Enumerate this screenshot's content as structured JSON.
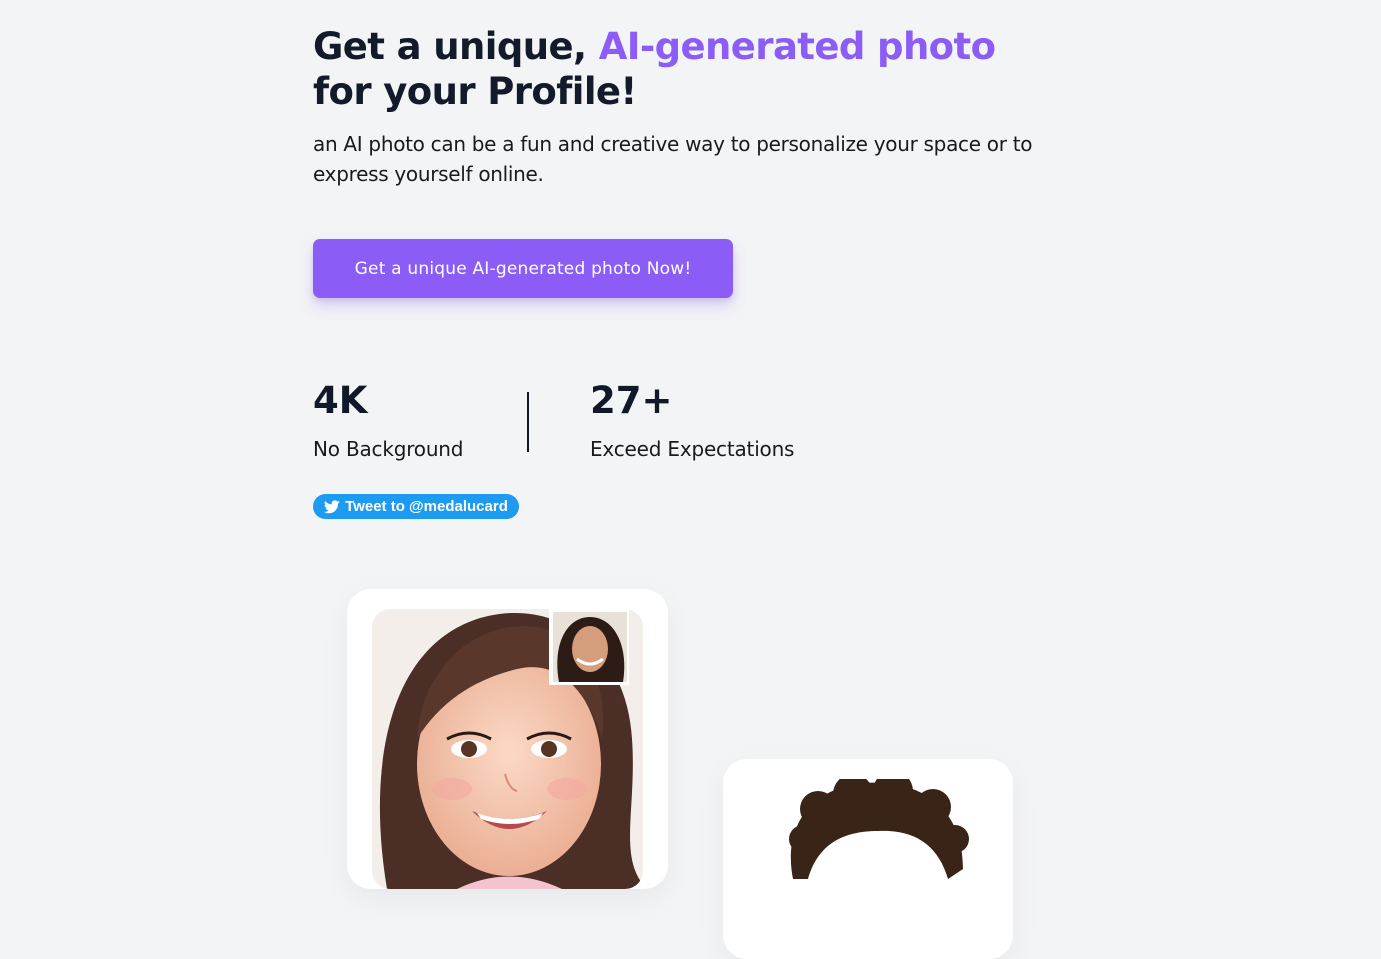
{
  "hero": {
    "title_part1": "Get a unique, ",
    "title_accent": "AI-generated photo",
    "title_part2": " for your Profile!",
    "subtitle": "an AI photo can be a fun and creative way to personalize your space or to express yourself online.",
    "cta_label": "Get a unique AI-generated photo Now!"
  },
  "stats": [
    {
      "value": "4K",
      "label": "No Background"
    },
    {
      "value": "27+",
      "label": "Exceed Expectations"
    }
  ],
  "tweet_button": {
    "label": "Tweet to @medalucard",
    "icon": "twitter-bird-icon"
  },
  "gallery": {
    "items": [
      {
        "name": "ai-portrait-woman",
        "inset": "original-photo-thumbnail"
      },
      {
        "name": "ai-portrait-man"
      }
    ]
  },
  "colors": {
    "accent": "#8b5cf6",
    "background": "#f3f4f6",
    "twitter": "#1d9bf0",
    "text": "#111827"
  }
}
